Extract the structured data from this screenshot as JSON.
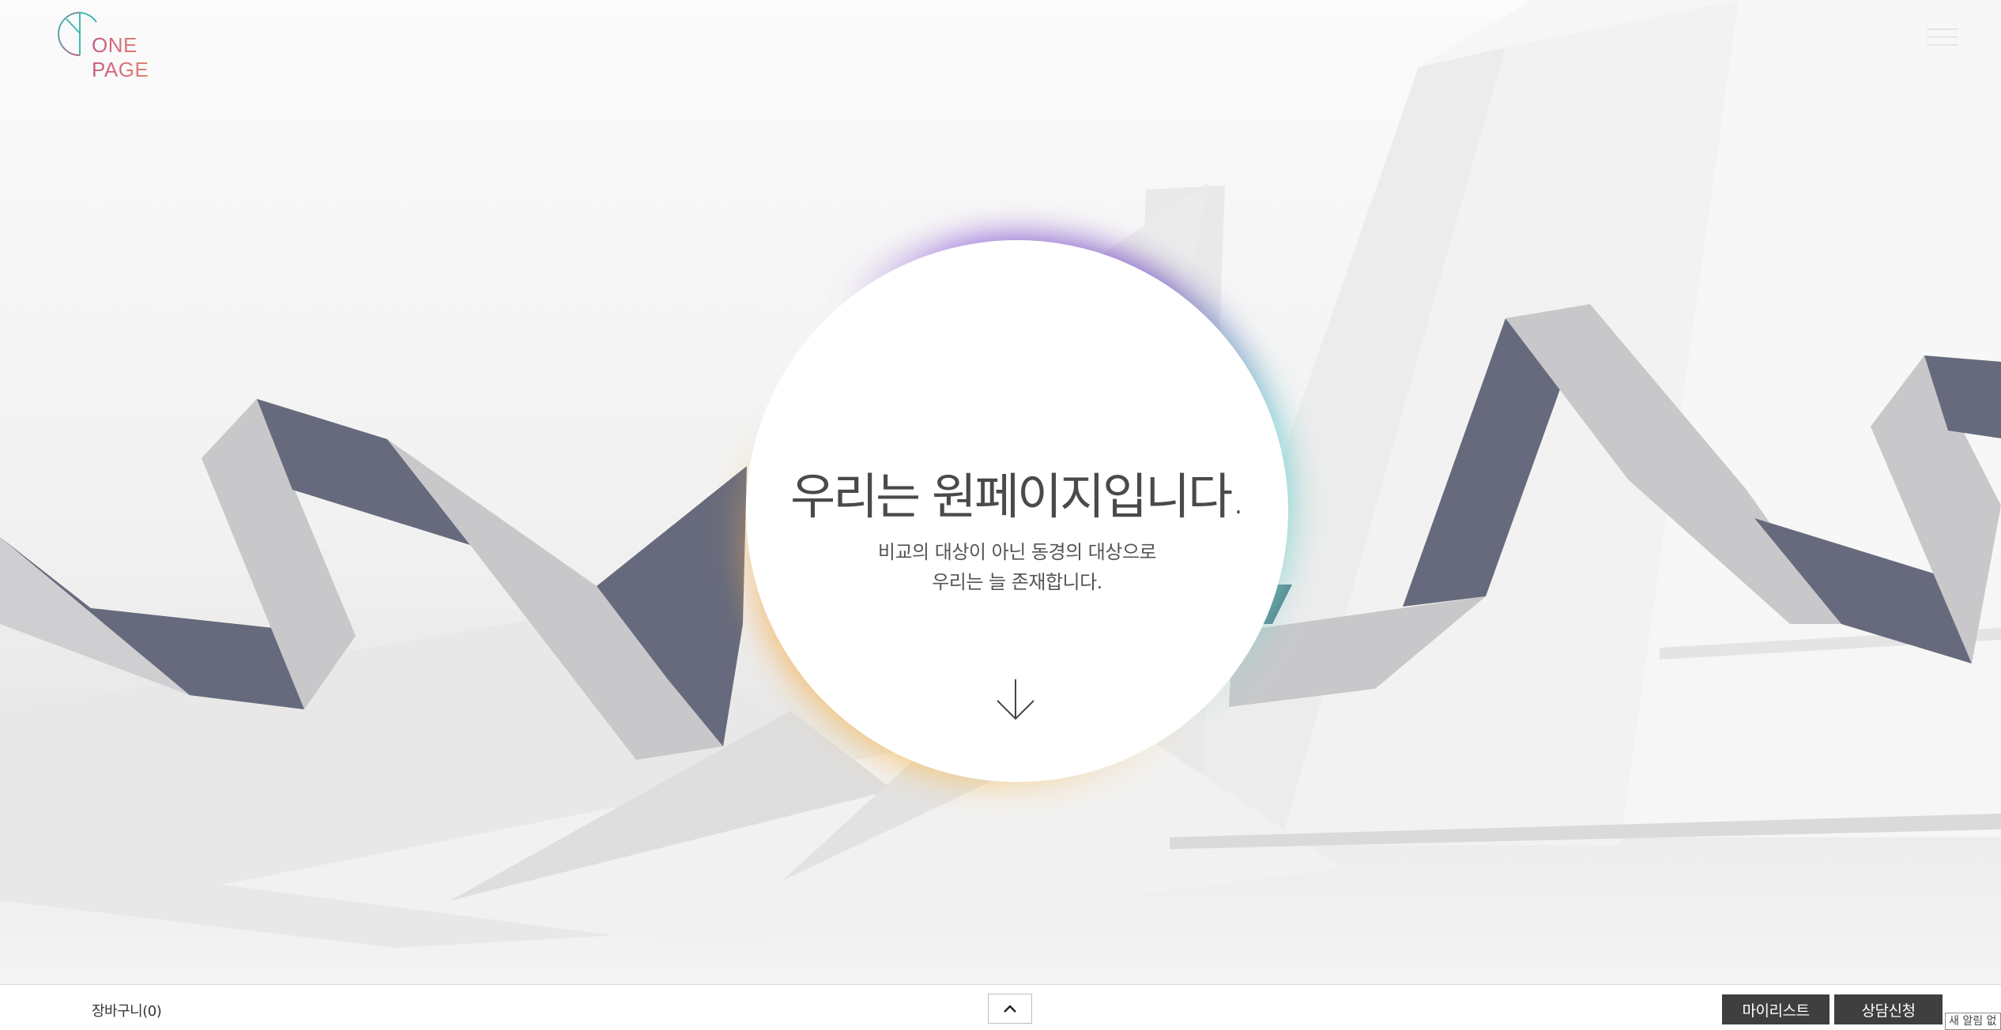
{
  "header": {
    "logo_text": "ONE PAGE",
    "menu_icon": "hamburger-icon"
  },
  "hero": {
    "headline": "우리는 원페이지입니다.",
    "subline_1": "비교의 대상이 아닌 동경의 대상으로",
    "subline_2": "우리는 늘 존재합니다.",
    "scroll_icon": "arrow-down-icon"
  },
  "bottombar": {
    "cart_label": "장바구니(0)",
    "top_icon": "chevron-up-icon",
    "mylist_label": "마이리스트",
    "consult_label": "상담신청",
    "notice_label": "새 알림 없"
  },
  "colors": {
    "ribbon_dark": "#666a7c",
    "ribbon_light": "#c8c8ca",
    "glow_orange": "#f6b35a",
    "glow_purple": "#6a3fb8",
    "glow_teal": "#5fc8c9",
    "button_dark": "#3f3f3f"
  }
}
